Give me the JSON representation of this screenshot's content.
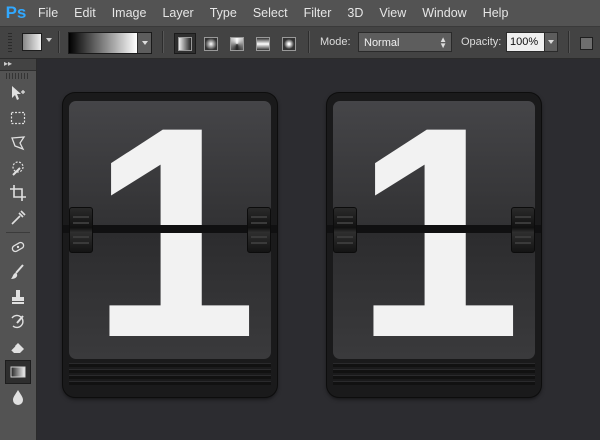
{
  "app": {
    "logo": "Ps"
  },
  "menu": [
    "File",
    "Edit",
    "Image",
    "Layer",
    "Type",
    "Select",
    "Filter",
    "3D",
    "View",
    "Window",
    "Help"
  ],
  "options_bar": {
    "mode_label": "Mode:",
    "mode_value": "Normal",
    "opacity_label": "Opacity:",
    "opacity_value": "100%",
    "gradient_types": [
      "linear-gradient-icon",
      "radial-gradient-icon",
      "angle-gradient-icon",
      "reflected-gradient-icon",
      "diamond-gradient-icon"
    ],
    "active_gradient_type": "linear-gradient-icon"
  },
  "toolbar": {
    "collapse_label": "▸▸",
    "tools": [
      "move-tool-icon",
      "marquee-tool-icon",
      "lasso-tool-icon",
      "quick-selection-tool-icon",
      "crop-tool-icon",
      "eyedropper-tool-icon",
      "spot-healing-tool-icon",
      "brush-tool-icon",
      "clone-stamp-tool-icon",
      "history-brush-tool-icon",
      "eraser-tool-icon",
      "gradient-tool-icon",
      "blur-tool-icon"
    ],
    "active_tool": "gradient-tool-icon"
  },
  "canvas": {
    "cards": [
      {
        "digit": "1"
      },
      {
        "digit": "1"
      }
    ]
  },
  "colors": {
    "ps_blue": "#31a8ff",
    "ui_bg": "#535353",
    "canvas_bg": "#2c2c30",
    "digit": "#f2f2f2"
  }
}
